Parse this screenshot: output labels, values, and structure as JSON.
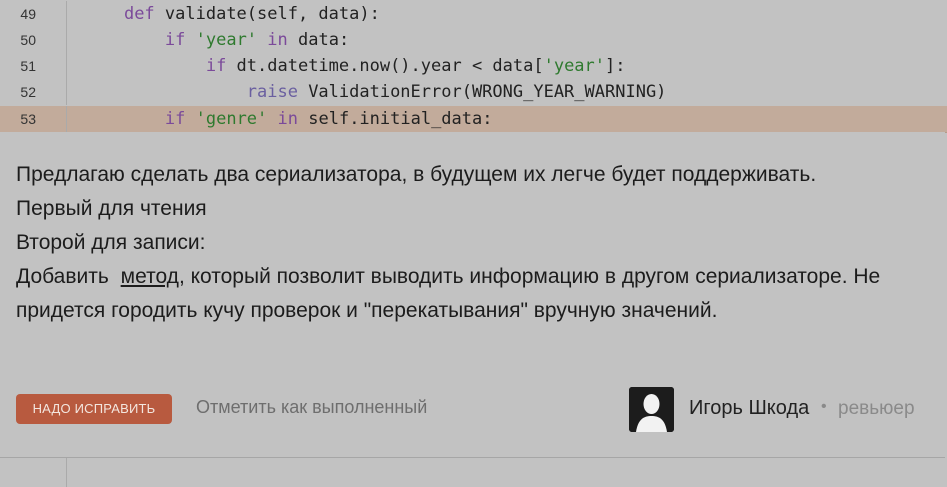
{
  "code": {
    "lines": [
      {
        "num": "49",
        "indent": "    ",
        "parts": [
          {
            "t": "def",
            "c": "kw"
          },
          {
            "t": " validate(self, data):",
            "c": ""
          }
        ]
      },
      {
        "num": "50",
        "indent": "        ",
        "parts": [
          {
            "t": "if",
            "c": "kw"
          },
          {
            "t": " ",
            "c": ""
          },
          {
            "t": "'year'",
            "c": "str"
          },
          {
            "t": " ",
            "c": ""
          },
          {
            "t": "in",
            "c": "kw"
          },
          {
            "t": " data:",
            "c": ""
          }
        ]
      },
      {
        "num": "51",
        "indent": "            ",
        "parts": [
          {
            "t": "if",
            "c": "kw"
          },
          {
            "t": " dt.datetime.now().year < data[",
            "c": ""
          },
          {
            "t": "'year'",
            "c": "str"
          },
          {
            "t": "]:",
            "c": ""
          }
        ]
      },
      {
        "num": "52",
        "indent": "                ",
        "parts": [
          {
            "t": "raise",
            "c": "kw2"
          },
          {
            "t": " ValidationError(WRONG_YEAR_WARNING)",
            "c": ""
          }
        ]
      },
      {
        "num": "53",
        "indent": "        ",
        "highlight": true,
        "parts": [
          {
            "t": "if",
            "c": "kw"
          },
          {
            "t": " ",
            "c": ""
          },
          {
            "t": "'genre'",
            "c": "str"
          },
          {
            "t": " ",
            "c": ""
          },
          {
            "t": "in",
            "c": "kw"
          },
          {
            "t": " self.initial_data:",
            "c": ""
          }
        ]
      }
    ]
  },
  "comment": {
    "line1": "Предлагаю сделать два сериализатора, в будущем их легче будет поддерживать.",
    "line2": "Первый для чтения",
    "line3": "Второй для записи:",
    "line4_before": "Добавить",
    "link_text": "метод",
    "line4_after": ", который позволит выводить информацию в другом сериализаторе. Не придется городить кучу проверок и \"перекатывания\" вручную значений."
  },
  "actions": {
    "fix_label": "НАДО ИСПРАВИТЬ",
    "mark_done_label": "Отметить как выполненный"
  },
  "reviewer": {
    "name": "Игорь Шкода",
    "separator": "•",
    "role": "ревьюер"
  }
}
